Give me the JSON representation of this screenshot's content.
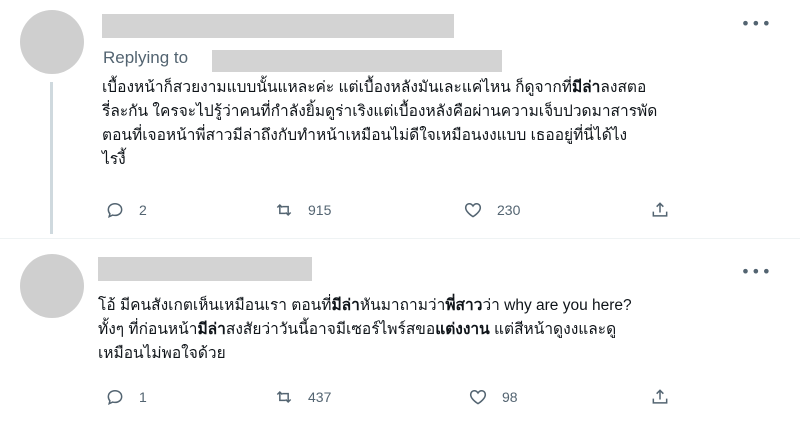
{
  "tweets": [
    {
      "replying_to": "Replying to",
      "segments": [
        {
          "t": "เบื้องหน้าก็สวยงามแบบนั้นแหละค่ะ แต่เบื้องหลังมันเละแค่ไหน ก็ดูจากที่",
          "b": false
        },
        {
          "t": "มีล่า",
          "b": true
        },
        {
          "t": "ลงสตอ\nรี่ละกัน ใครจะไปรู้ว่าคนที่กำลังยิ้มดูร่าเริงแต่เบื้องหลังคือผ่านความเจ็บปวดมาสารพัด\nตอนที่เจอหน้าพี่สาวมีล่าถึงกับทำหน้าเหมือนไม่ดีใจเหมือนงงแบบ เธออยู่ที่นี่ได้ไง\nไรงี้",
          "b": false
        }
      ],
      "counts": {
        "reply": "2",
        "retweet": "915",
        "like": "230"
      }
    },
    {
      "segments": [
        {
          "t": "โอ้ มีคนสังเกตเห็นเหมือนเรา ตอนที่",
          "b": false
        },
        {
          "t": "มีล่า",
          "b": true
        },
        {
          "t": "หันมาถามว่า",
          "b": false
        },
        {
          "t": "พี่สาว",
          "b": true
        },
        {
          "t": "ว่า why are you here?\nทั้งๆ ที่ก่อนหน้า",
          "b": false
        },
        {
          "t": "มีล่า",
          "b": true
        },
        {
          "t": "สงสัยว่าวันนี้อาจมีเซอร์ไพร์สขอ",
          "b": false
        },
        {
          "t": "แต่งงาน",
          "b": true
        },
        {
          "t": " แต่สีหน้าดูงงและดู\nเหมือนไม่พอใจด้วย",
          "b": false
        }
      ],
      "counts": {
        "reply": "1",
        "retweet": "437",
        "like": "98"
      }
    }
  ],
  "icons": {
    "reply": "reply-icon",
    "retweet": "retweet-icon",
    "like": "heart-icon",
    "share": "share-icon",
    "more": "more-icon"
  },
  "colors": {
    "text": "#0f1419",
    "muted": "#536471",
    "placeholder": "#d3d3d3",
    "avatar": "#cfcfcf"
  }
}
